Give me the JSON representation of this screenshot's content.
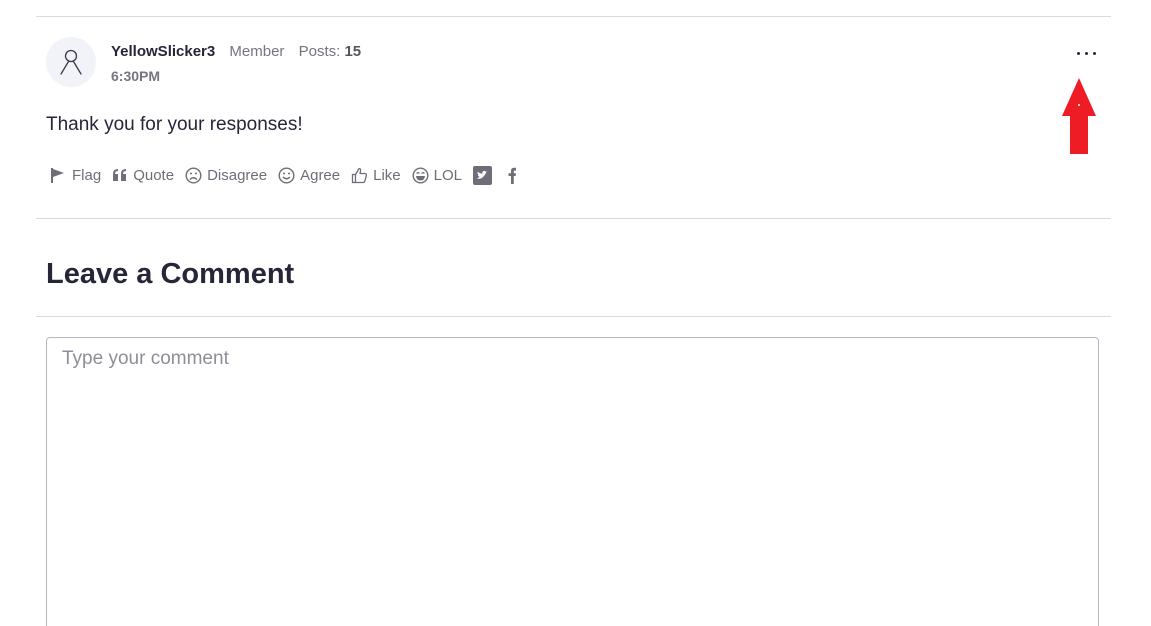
{
  "post": {
    "author_name": "YellowSlicker3",
    "author_role": "Member",
    "posts_label": "Posts:",
    "posts_count": "15",
    "time": "6:30PM",
    "body": "Thank you for your responses!"
  },
  "reactions": [
    {
      "label": "Flag",
      "icon": "flag-icon"
    },
    {
      "label": "Quote",
      "icon": "quote-icon"
    },
    {
      "label": "Disagree",
      "icon": "frown-icon"
    },
    {
      "label": "Agree",
      "icon": "smile-icon"
    },
    {
      "label": "Like",
      "icon": "thumbs-up-icon"
    },
    {
      "label": "LOL",
      "icon": "laugh-icon"
    }
  ],
  "share": [
    {
      "icon": "twitter-icon"
    },
    {
      "icon": "facebook-icon"
    }
  ],
  "comment_section": {
    "heading": "Leave a Comment",
    "placeholder": "Type your comment"
  },
  "colors": {
    "annotation_arrow": "#ee1c25",
    "text": "#262639",
    "muted": "#757580"
  }
}
